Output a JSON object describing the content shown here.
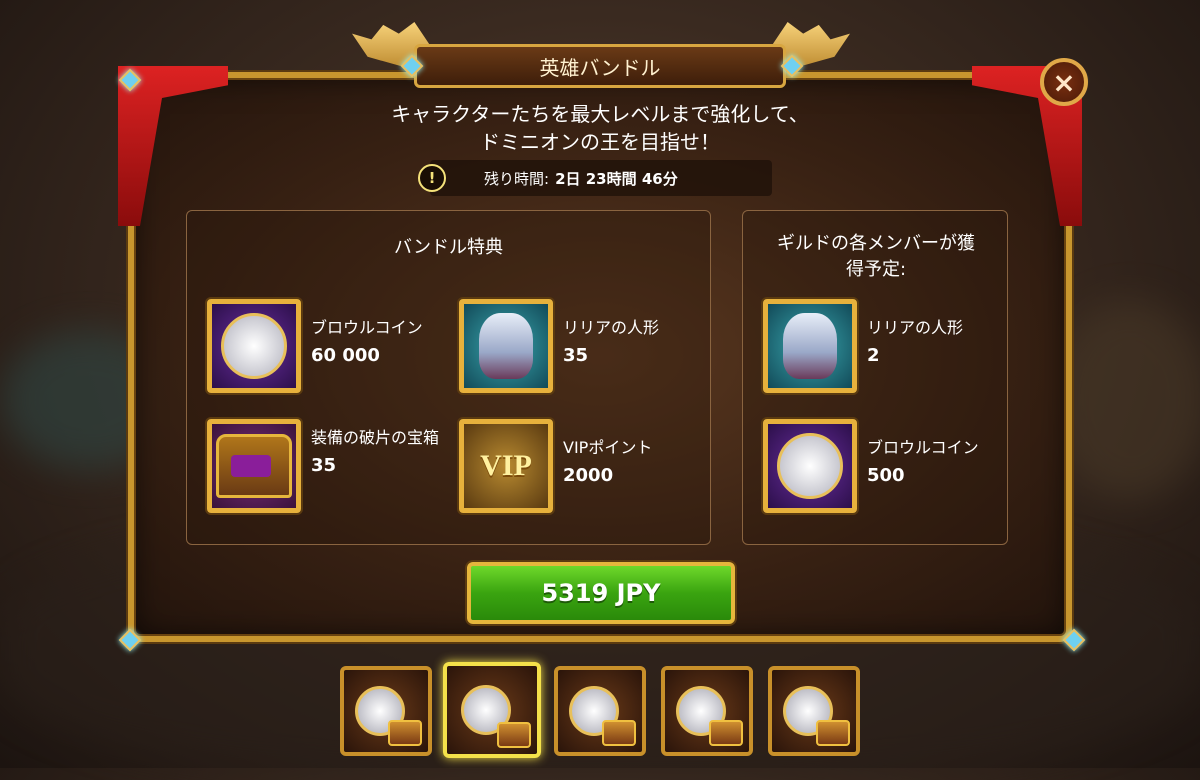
{
  "title": "英雄バンドル",
  "subtitle_line1": "キャラクターたちを最大レベルまで強化して、",
  "subtitle_line2": "ドミニオンの王を目指せ！",
  "timer": {
    "icon": "!",
    "label": "残り時間:",
    "value": "2日 23時間 46分"
  },
  "bundle_section": {
    "title": "バンドル特典",
    "items": [
      {
        "name": "ブロウルコイン",
        "qty": "60 000",
        "icon": "brawl-coin-icon"
      },
      {
        "name": "リリアの人形",
        "qty": "35",
        "icon": "lilia-doll-icon"
      },
      {
        "name": "装備の破片の宝箱",
        "qty": "35",
        "icon": "gear-shard-chest-icon"
      },
      {
        "name": "VIPポイント",
        "qty": "2000",
        "icon": "vip-points-icon",
        "icon_text": "VIP"
      }
    ]
  },
  "guild_section": {
    "title": "ギルドの各メンバーが獲得予定:",
    "items": [
      {
        "name": "リリアの人形",
        "qty": "2",
        "icon": "lilia-doll-icon"
      },
      {
        "name": "ブロウルコイン",
        "qty": "500",
        "icon": "brawl-coin-icon"
      }
    ]
  },
  "buy_button": "5319 JPY",
  "close_icon": "×",
  "tabs": {
    "count": 5,
    "selected_index": 1
  }
}
